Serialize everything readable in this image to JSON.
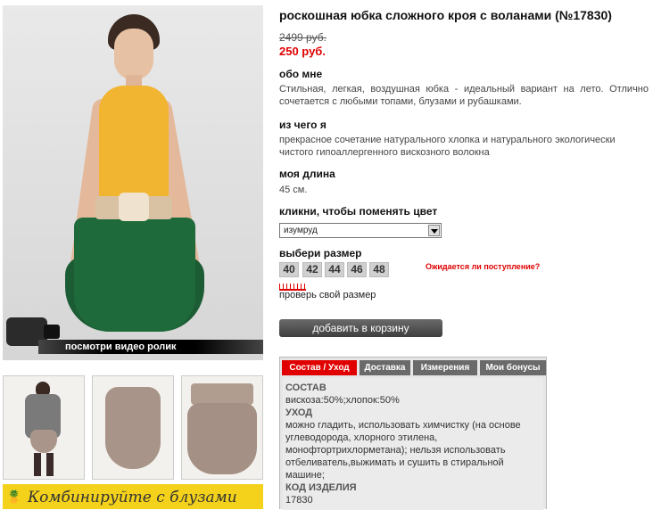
{
  "product": {
    "title": "роскошная юбка сложного кроя с воланами (№17830)",
    "old_price": "2499 руб.",
    "new_price": "250 руб."
  },
  "about": {
    "heading": "обо мне",
    "text": "Стильная, легкая, воздушная юбка - идеальный вариант на лето. Отлично сочетается с любыми топами, блузами и рубашками."
  },
  "material": {
    "heading": "из чего я",
    "text": "прекрасное сочетание натурального хлопка и натурального экологически чистого гипоаллергенного вискозного волокна"
  },
  "length": {
    "heading": "моя длина",
    "value": "45 см."
  },
  "color": {
    "heading": "кликни, чтобы поменять цвет",
    "selected": "изумруд"
  },
  "sizes": {
    "heading": "выбери размер",
    "options": [
      "40",
      "42",
      "44",
      "46",
      "48"
    ],
    "expected_link": "Ожидается ли поступление?",
    "check_size": "проверь свой размер"
  },
  "cart_button": "добавить в корзину",
  "video_banner": "посмотри видео ролик",
  "combine_banner": "Комбинируйте с блузами",
  "tabs": [
    {
      "label": "Состав / Уход",
      "active": true
    },
    {
      "label": "Доставка",
      "active": false
    },
    {
      "label": "Измерения",
      "active": false
    },
    {
      "label": "Мои бонусы",
      "active": false
    }
  ],
  "composition": {
    "heading": "СОСТАВ",
    "text": "вискоза:50%;хлопок:50%",
    "care_heading": "УХОД",
    "care_text": "можно гладить, использовать химчистку (на основе углеводорода, хлорного этилена, монофтортрихлорметана); нельзя использовать отбеливатель,выжимать и сушить в стиральной машине;",
    "code_heading": "КОД ИЗДЕЛИЯ",
    "code": "17830"
  },
  "colors": {
    "accent_red": "#e00000",
    "tab_gray": "#6a6a6a",
    "skirt_green": "#1f6a3b",
    "banner_yellow": "#f4d21b"
  }
}
